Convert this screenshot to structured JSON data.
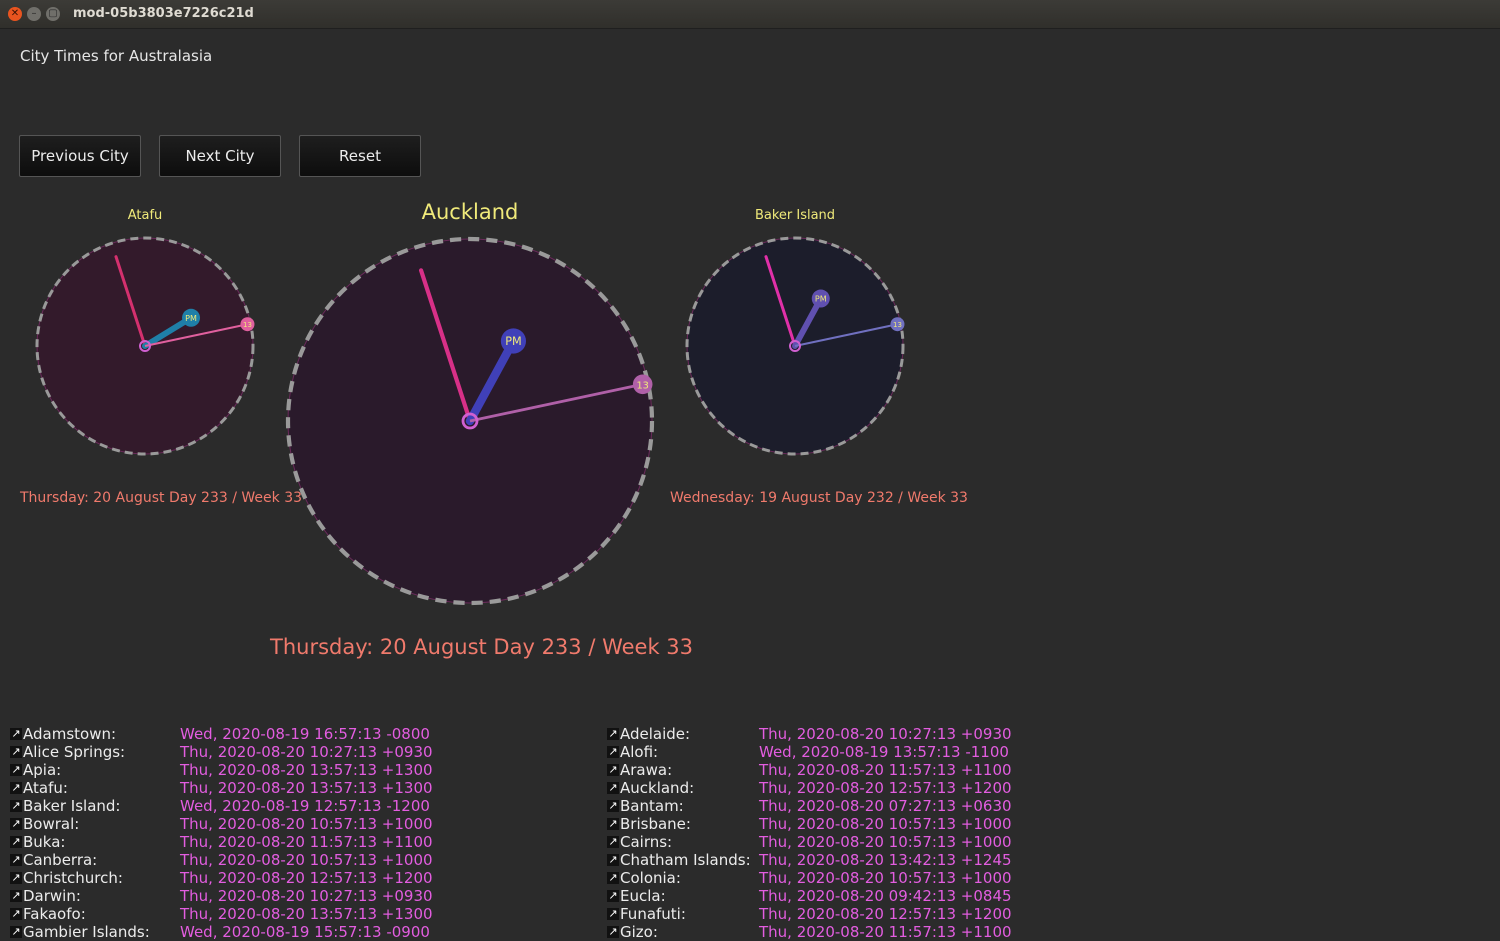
{
  "window": {
    "title": "mod-05b3803e7226c21d"
  },
  "app": {
    "title": "City Times for Australasia"
  },
  "buttons": {
    "previous": "Previous City",
    "next": "Next City",
    "reset": "Reset"
  },
  "clocks": {
    "left": {
      "city": "Atafu",
      "date": "Thursday: 20 August Day 233 / Week 33",
      "hour": 1,
      "minute": 57,
      "second": 13,
      "ampm": "PM",
      "face_color": "#331a2b",
      "hand_color": "#1f7fa8",
      "second_color": "#e0609e",
      "minute_color": "#d4306e"
    },
    "main": {
      "city": "Auckland",
      "date": "Thursday: 20 August Day 233 / Week 33",
      "hour": 12,
      "minute": 57,
      "second": 13,
      "ampm": "PM",
      "face_color": "#2a1a2b",
      "hand_color": "#4040b8",
      "second_color": "#b060a8",
      "minute_color": "#d83088"
    },
    "right": {
      "city": "Baker Island",
      "date": "Wednesday: 19 August Day 232 / Week 33",
      "hour": 12,
      "minute": 57,
      "second": 13,
      "ampm": "PM",
      "face_color": "#1c1d2b",
      "hand_color": "#6050b0",
      "second_color": "#7070c0",
      "minute_color": "#e030a8"
    }
  },
  "timezones": {
    "left": [
      {
        "name": "Adamstown:",
        "time": "Wed, 2020-08-19 16:57:13 -0800"
      },
      {
        "name": "Alice Springs:",
        "time": "Thu, 2020-08-20 10:27:13 +0930"
      },
      {
        "name": "Apia:",
        "time": "Thu, 2020-08-20 13:57:13 +1300"
      },
      {
        "name": "Atafu:",
        "time": "Thu, 2020-08-20 13:57:13 +1300"
      },
      {
        "name": "Baker Island:",
        "time": "Wed, 2020-08-19 12:57:13 -1200"
      },
      {
        "name": "Bowral:",
        "time": "Thu, 2020-08-20 10:57:13 +1000"
      },
      {
        "name": "Buka:",
        "time": "Thu, 2020-08-20 11:57:13 +1100"
      },
      {
        "name": "Canberra:",
        "time": "Thu, 2020-08-20 10:57:13 +1000"
      },
      {
        "name": "Christchurch:",
        "time": "Thu, 2020-08-20 12:57:13 +1200"
      },
      {
        "name": "Darwin:",
        "time": "Thu, 2020-08-20 10:27:13 +0930"
      },
      {
        "name": "Fakaofo:",
        "time": "Thu, 2020-08-20 13:57:13 +1300"
      },
      {
        "name": "Gambier Islands:",
        "time": "Wed, 2020-08-19 15:57:13 -0900"
      }
    ],
    "right": [
      {
        "name": "Adelaide:",
        "time": "Thu, 2020-08-20 10:27:13 +0930"
      },
      {
        "name": "Alofi:",
        "time": "Wed, 2020-08-19 13:57:13 -1100"
      },
      {
        "name": "Arawa:",
        "time": "Thu, 2020-08-20 11:57:13 +1100"
      },
      {
        "name": "Auckland:",
        "time": "Thu, 2020-08-20 12:57:13 +1200"
      },
      {
        "name": "Bantam:",
        "time": "Thu, 2020-08-20 07:27:13 +0630"
      },
      {
        "name": "Brisbane:",
        "time": "Thu, 2020-08-20 10:57:13 +1000"
      },
      {
        "name": "Cairns:",
        "time": "Thu, 2020-08-20 10:57:13 +1000"
      },
      {
        "name": "Chatham Islands:",
        "time": "Thu, 2020-08-20 13:42:13 +1245"
      },
      {
        "name": "Colonia:",
        "time": "Thu, 2020-08-20 10:57:13 +1000"
      },
      {
        "name": "Eucla:",
        "time": "Thu, 2020-08-20 09:42:13 +0845"
      },
      {
        "name": "Funafuti:",
        "time": "Thu, 2020-08-20 12:57:13 +1200"
      },
      {
        "name": "Gizo:",
        "time": "Thu, 2020-08-20 11:57:13 +1100"
      }
    ]
  }
}
